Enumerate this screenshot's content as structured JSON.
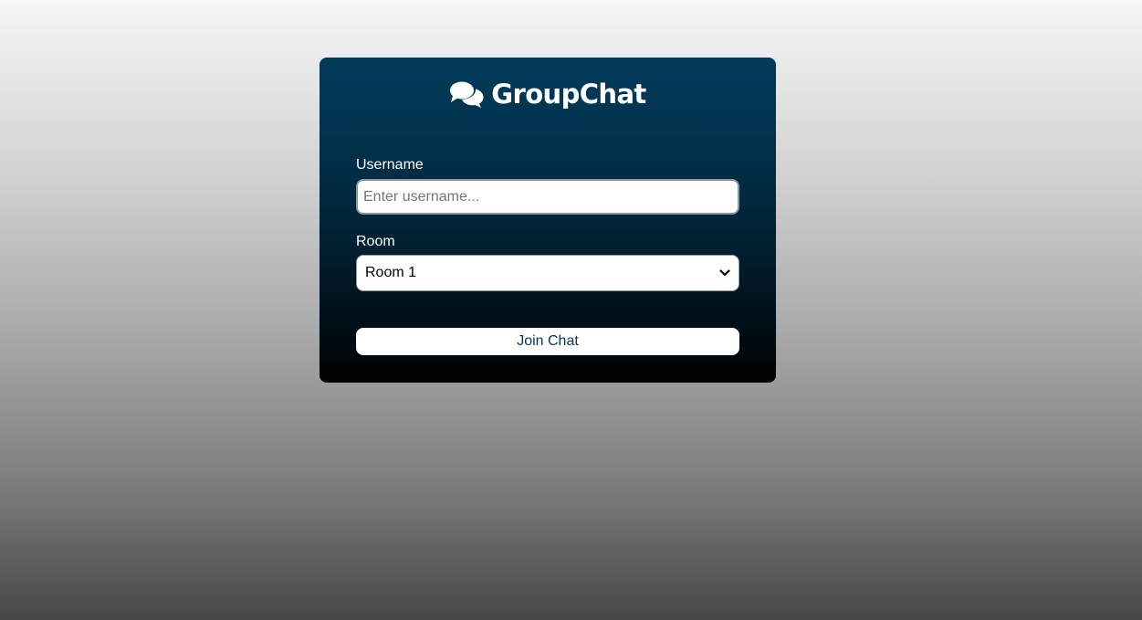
{
  "header": {
    "logo_icon": "comments-icon",
    "title": "GroupChat"
  },
  "form": {
    "username_label": "Username",
    "username_placeholder": "Enter username...",
    "username_value": "",
    "room_label": "Room",
    "room_selected": "Room 1",
    "join_button_label": "Join Chat"
  },
  "colors": {
    "card_top": "#023a5b",
    "card_bottom": "#000000",
    "button_text": "#023a5b"
  }
}
